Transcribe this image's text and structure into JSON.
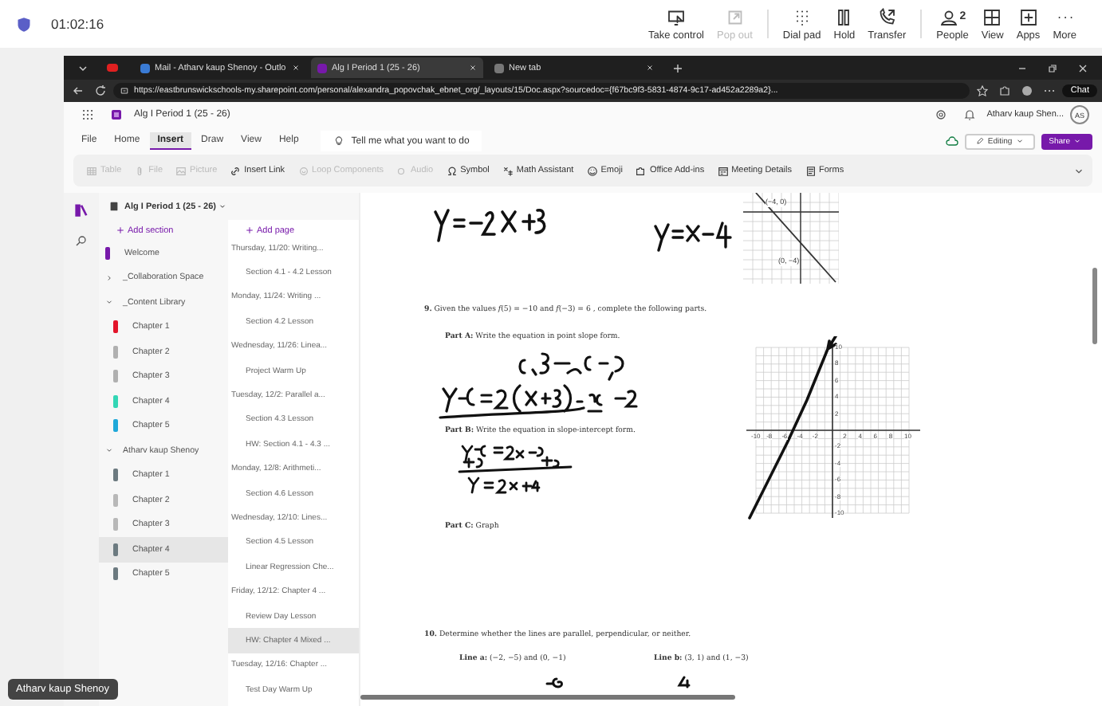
{
  "meeting": {
    "timer": "01:02:16",
    "controls": [
      {
        "label": "Take control",
        "disabled": false
      },
      {
        "label": "Pop out",
        "disabled": true
      },
      {
        "label": "Dial pad",
        "disabled": false
      },
      {
        "label": "Hold",
        "disabled": false
      },
      {
        "label": "Transfer",
        "disabled": false
      },
      {
        "label": "People",
        "disabled": false,
        "badge": "2"
      },
      {
        "label": "View",
        "disabled": false
      },
      {
        "label": "Apps",
        "disabled": false
      },
      {
        "label": "More",
        "disabled": false
      }
    ],
    "presenter": "Atharv kaup Shenoy"
  },
  "browser": {
    "tabs": [
      {
        "kind": "video",
        "selected": false
      },
      {
        "kind": "page",
        "title": "Mail - Atharv kaup Shenoy - Outlo",
        "selected": false
      },
      {
        "kind": "page",
        "title": "Alg I Period 1 (25 - 26)",
        "selected": true
      },
      {
        "kind": "page",
        "title": "New tab",
        "selected": false
      }
    ],
    "url": "https://eastbrunswickschools-my.sharepoint.com/personal/alexandra_popovchak_ebnet_org/_layouts/15/Doc.aspx?sourcedoc={f67bc9f3-5831-4874-9c17-ad452a2289a2}...",
    "chat": "Chat"
  },
  "app": {
    "title": "Alg I Period 1 (25 - 26)",
    "user": "Atharv kaup Shen...",
    "initials": "AS",
    "menu": [
      {
        "label": "File",
        "selected": false
      },
      {
        "label": "Home",
        "selected": false
      },
      {
        "label": "Insert",
        "selected": true
      },
      {
        "label": "Draw",
        "selected": false
      },
      {
        "label": "View",
        "selected": false
      },
      {
        "label": "Help",
        "selected": false
      }
    ],
    "tell_me": "Tell me what you want to do",
    "editing": "Editing",
    "share": "Share",
    "ribbon": [
      {
        "label": "Table",
        "disabled": true
      },
      {
        "label": "File",
        "disabled": true
      },
      {
        "label": "Picture",
        "disabled": true
      },
      {
        "label": "Insert Link",
        "disabled": false
      },
      {
        "label": "Loop Components",
        "disabled": true
      },
      {
        "label": "Audio",
        "disabled": true
      },
      {
        "label": "Symbol",
        "disabled": false
      },
      {
        "label": "Math Assistant",
        "disabled": false
      },
      {
        "label": "Emoji",
        "disabled": false
      },
      {
        "label": "Office Add-ins",
        "disabled": false
      },
      {
        "label": "Meeting Details",
        "disabled": false
      },
      {
        "label": "Forms",
        "disabled": false
      }
    ]
  },
  "sidebar": {
    "notebook": "Alg I Period 1 (25 - 26)",
    "add_section": "Add section",
    "sections": [
      {
        "kind": "section",
        "label": "Welcome",
        "color": "#7719aa",
        "selected": false
      },
      {
        "kind": "group",
        "label": "_Collaboration Space",
        "expanded": false,
        "selected": false
      },
      {
        "kind": "group",
        "label": "_Content Library",
        "expanded": true,
        "selected": false,
        "children": [
          {
            "kind": "section",
            "label": "Chapter 1",
            "color": "#e3152b",
            "selected": false
          },
          {
            "kind": "section",
            "label": "Chapter 2",
            "color": "#b0b0b0",
            "selected": false
          },
          {
            "kind": "section",
            "label": "Chapter 3",
            "color": "#b0b0b0",
            "selected": false
          },
          {
            "kind": "section",
            "label": "Chapter 4",
            "color": "#33d6b5",
            "selected": false
          },
          {
            "kind": "section",
            "label": "Chapter 5",
            "color": "#1fa8d9",
            "selected": false
          }
        ]
      },
      {
        "kind": "group",
        "label": "Atharv kaup Shenoy",
        "expanded": true,
        "selected": false,
        "children": [
          {
            "kind": "section",
            "label": "Chapter 1",
            "color": "#6c7a80",
            "selected": false
          },
          {
            "kind": "section",
            "label": "Chapter 2",
            "color": "#b8b8b8",
            "selected": false
          },
          {
            "kind": "section",
            "label": "Chapter 3",
            "color": "#b8b8b8",
            "selected": false
          },
          {
            "kind": "section",
            "label": "Chapter 4",
            "color": "#6c7a80",
            "selected": true
          },
          {
            "kind": "section",
            "label": "Chapter 5",
            "color": "#6c7a80",
            "selected": false
          }
        ]
      }
    ]
  },
  "pages": {
    "add_page": "Add page",
    "items": [
      {
        "title": "Thursday, 11/20: Writing...",
        "selected": false,
        "children": [
          {
            "title": "Section 4.1 - 4.2 Lesson",
            "selected": false
          }
        ]
      },
      {
        "title": "Monday, 11/24: Writing ...",
        "selected": false,
        "children": [
          {
            "title": "Section 4.2 Lesson",
            "selected": false
          }
        ]
      },
      {
        "title": "Wednesday, 11/26: Linea...",
        "selected": false,
        "children": [
          {
            "title": "Project Warm Up",
            "selected": false
          }
        ]
      },
      {
        "title": "Tuesday, 12/2: Parallel a...",
        "selected": false,
        "children": [
          {
            "title": "Section 4.3 Lesson",
            "selected": false
          },
          {
            "title": "HW: Section 4.1 - 4.3 ...",
            "selected": false
          }
        ]
      },
      {
        "title": "Monday, 12/8: Arithmeti...",
        "selected": false,
        "children": [
          {
            "title": "Section 4.6 Lesson",
            "selected": false
          }
        ]
      },
      {
        "title": "Wednesday, 12/10: Lines...",
        "selected": false,
        "children": [
          {
            "title": "Section 4.5 Lesson",
            "selected": false
          },
          {
            "title": "Linear Regression Che...",
            "selected": false
          }
        ]
      },
      {
        "title": "Friday, 12/12: Chapter 4 ...",
        "selected": false,
        "children": [
          {
            "title": "Review Day Lesson",
            "selected": false
          },
          {
            "title": "HW: Chapter 4 Mixed ...",
            "selected": true
          }
        ]
      },
      {
        "title": "Tuesday, 12/16: Chapter ...",
        "selected": false,
        "children": [
          {
            "title": "Test Day Warm Up",
            "selected": false
          }
        ]
      }
    ]
  },
  "page": {
    "small_graph": {
      "labels": [
        "(−4, 0)",
        "(0, −4)"
      ]
    },
    "problem_9": "**9.** Given the values *f*(5) = −10 and *f*(−3) = 6 , complete the following parts.",
    "part_a": "**Part A:** Write the equation in point slope form.",
    "part_b": "**Part B:** Write the equation in slope-intercept form.",
    "part_c": "**Part C:** Graph",
    "graph": {
      "x_ticks": [
        "-10",
        "-8",
        "-6",
        "-4",
        "-2",
        "2",
        "4",
        "6",
        "8",
        "10"
      ],
      "y_ticks": [
        "10",
        "8",
        "6",
        "4",
        "2",
        "-2",
        "-4",
        "-6",
        "-8",
        "-10"
      ]
    },
    "problem_10": "**10.** Determine whether the lines are parallel, perpendicular, or neither.",
    "line_a": "**Line a:** (−2, −5) and (0, −1)",
    "line_b": "**Line b:** (3, 1) and (1, −3)"
  }
}
